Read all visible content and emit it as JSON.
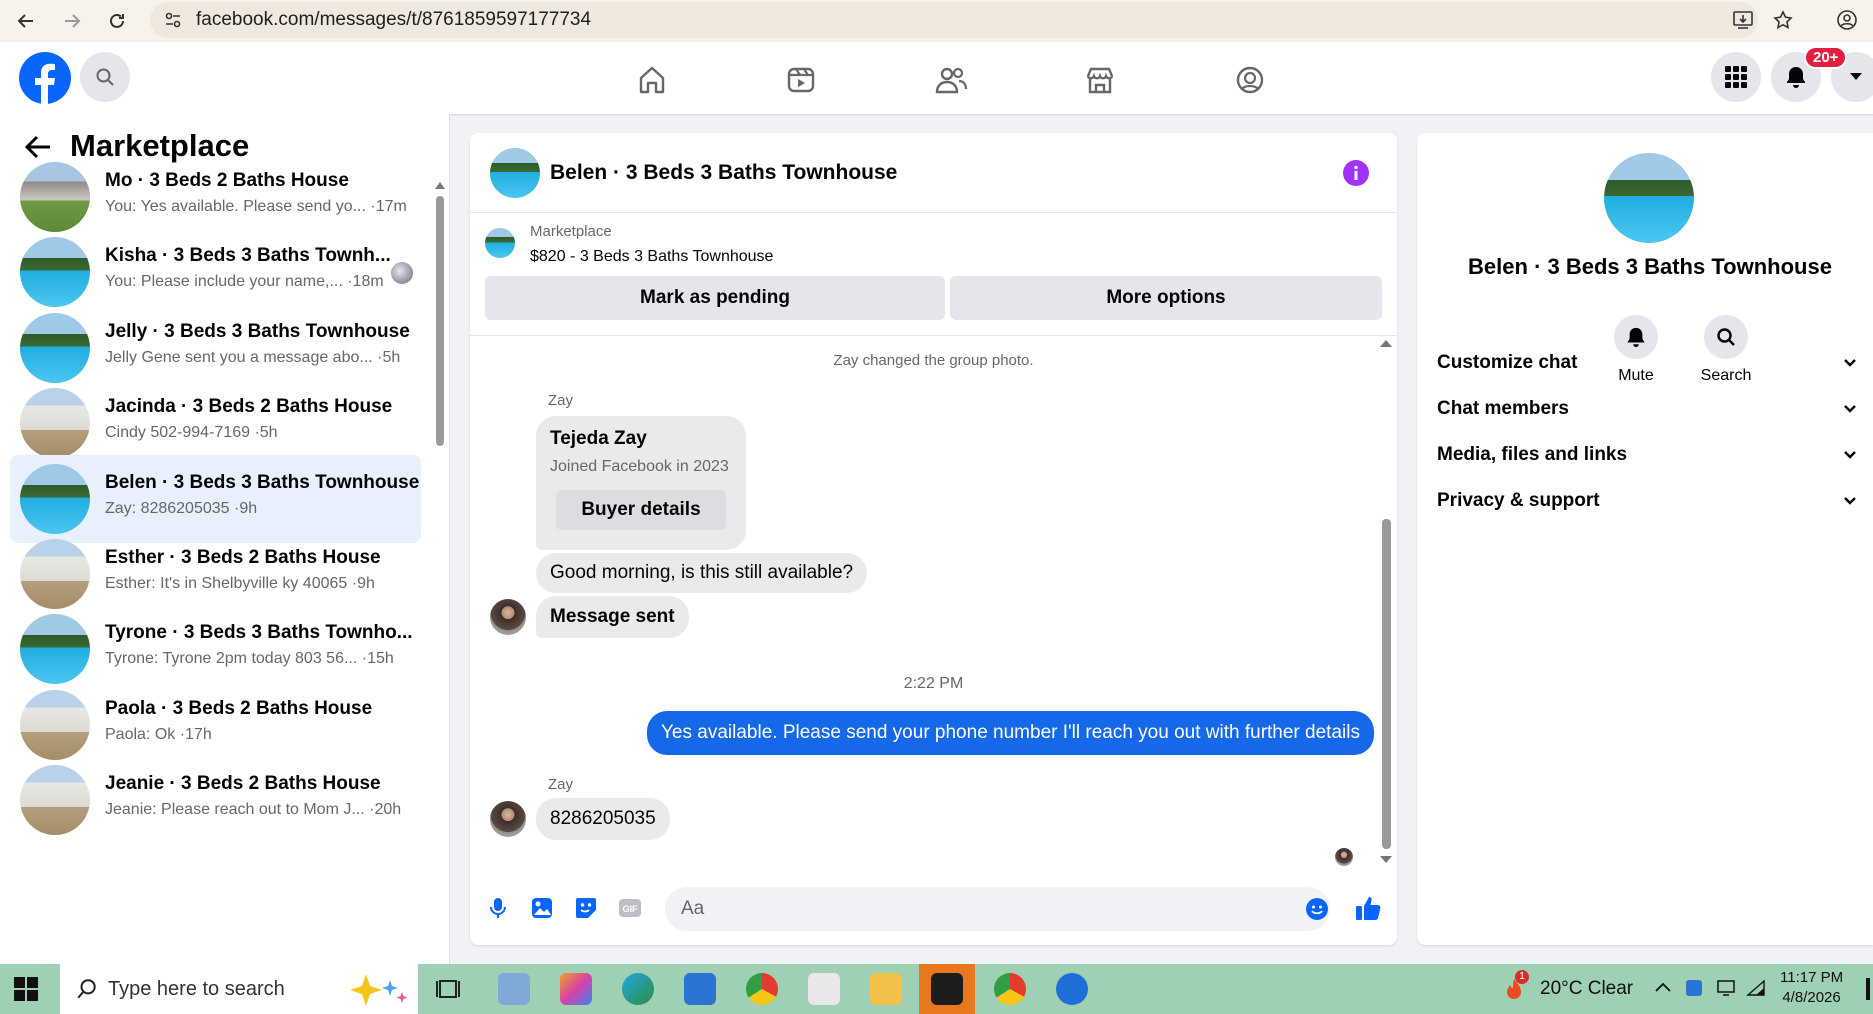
{
  "browser": {
    "url": "facebook.com/messages/t/8761859597177734"
  },
  "header": {
    "notification_badge": "20+"
  },
  "sidebar": {
    "title": "Marketplace",
    "conversations": [
      {
        "title": "Mo · 3 Beds 2 Baths House",
        "preview": "You: Yes available. Please send yo... ·17m",
        "thumb": "house2",
        "active": false
      },
      {
        "title": "Kisha · 3 Beds 3 Baths Townh...",
        "preview": "You: Please include your name,... ·18m",
        "thumb": "pool",
        "active": false
      },
      {
        "title": "Jelly · 3 Beds 3 Baths Townhouse",
        "preview": "Jelly Gene sent you a message abo... ·5h",
        "thumb": "pool",
        "active": false
      },
      {
        "title": "Jacinda · 3 Beds 2 Baths House",
        "preview": "Cindy 502-994-7169 ·5h",
        "thumb": "house",
        "active": false
      },
      {
        "title": "Belen · 3 Beds 3 Baths Townhouse",
        "preview": "Zay: 8286205035 ·9h",
        "thumb": "pool",
        "active": true
      },
      {
        "title": "Esther · 3 Beds 2 Baths House",
        "preview": "Esther: It's in Shelbyville ky 40065 ·9h",
        "thumb": "house",
        "active": false
      },
      {
        "title": "Tyrone · 3 Beds 3 Baths Townho...",
        "preview": "Tyrone: Tyrone 2pm today 803 56... ·15h",
        "thumb": "pool",
        "active": false
      },
      {
        "title": "Paola · 3 Beds 2 Baths House",
        "preview": "Paola: Ok ·17h",
        "thumb": "house",
        "active": false
      },
      {
        "title": "Jeanie · 3 Beds 2 Baths House",
        "preview": "Jeanie: Please reach out to Mom J... ·20h",
        "thumb": "house",
        "active": false
      }
    ]
  },
  "chat": {
    "title": "Belen · 3 Beds 3 Baths Townhouse",
    "listing_source": "Marketplace",
    "listing_title": "$820 - 3 Beds 3 Baths Townhouse",
    "mark_pending_label": "Mark as pending",
    "more_options_label": "More options",
    "system_message": "Zay changed the group photo.",
    "sender_name": "Zay",
    "profile_card_name": "Tejeda Zay",
    "profile_card_sub": "Joined Facebook in 2023",
    "buyer_details_label": "Buyer details",
    "msg_available": "Good morning, is this still available?",
    "msg_sent": "Message sent",
    "timestamp": "2:22 PM",
    "msg_outgoing": "Yes available. Please send your phone number  I'll reach you out with further details",
    "sender_name_2": "Zay",
    "msg_phone": "8286205035",
    "composer_placeholder": "Aa"
  },
  "details": {
    "title": "Belen · 3 Beds 3 Baths Townhouse",
    "mute_label": "Mute",
    "search_label": "Search",
    "sections": [
      "Customize chat",
      "Chat members",
      "Media, files and links",
      "Privacy & support"
    ]
  },
  "taskbar": {
    "search_placeholder": "Type here to search",
    "weather": "20°C  Clear",
    "time": "11:17 PM",
    "date": "4/8/2026",
    "weather_badge": "1"
  },
  "colors": {
    "fb_blue": "#0866ff",
    "outgoing_bubble": "#1569e8",
    "active_row": "#e7f0fc",
    "info_purple": "#a033ff",
    "notification_red": "#e41e3f"
  }
}
